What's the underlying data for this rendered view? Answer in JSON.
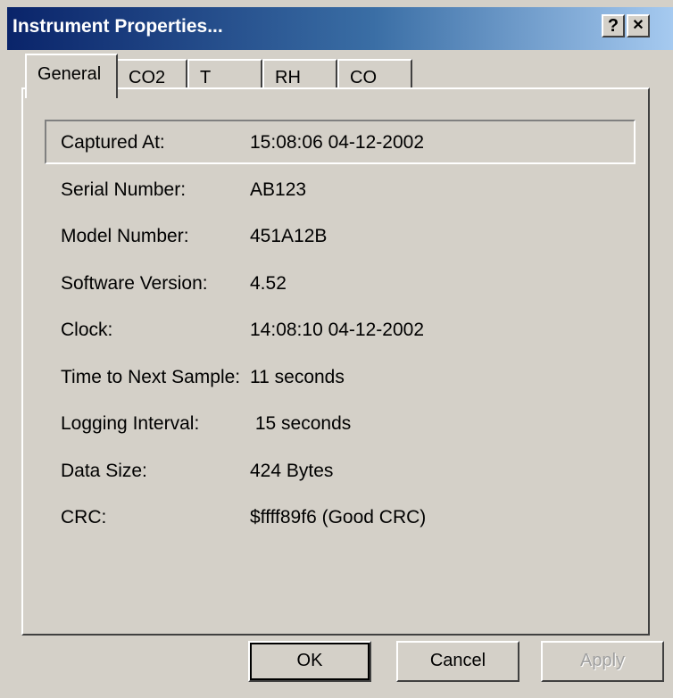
{
  "window": {
    "title": "Instrument Properties...",
    "help_icon": "?",
    "close_icon": "✕"
  },
  "tabs": [
    {
      "label": "General",
      "active": true
    },
    {
      "label": "CO2"
    },
    {
      "label": "T"
    },
    {
      "label": "RH"
    },
    {
      "label": "CO"
    }
  ],
  "properties": [
    {
      "label": "Captured At:",
      "value": "15:08:06 04-12-2002"
    },
    {
      "label": "Serial Number:",
      "value": "AB123"
    },
    {
      "label": "Model Number:",
      "value": "451A12B"
    },
    {
      "label": "Software Version:",
      "value": "4.52"
    },
    {
      "label": "Clock:",
      "value": "14:08:10 04-12-2002"
    },
    {
      "label": "Time to Next Sample:",
      "value": "11 seconds"
    },
    {
      "label": "Logging Interval:",
      "value": " 15 seconds"
    },
    {
      "label": "Data Size:",
      "value": "424 Bytes"
    },
    {
      "label": "CRC:",
      "value": "$ffff89f6 (Good CRC)"
    }
  ],
  "buttons": {
    "ok": "OK",
    "cancel": "Cancel",
    "apply": "Apply"
  },
  "colors": {
    "title_start": "#0a246a",
    "title_end": "#a6caf0",
    "face": "#d4d0c8"
  }
}
